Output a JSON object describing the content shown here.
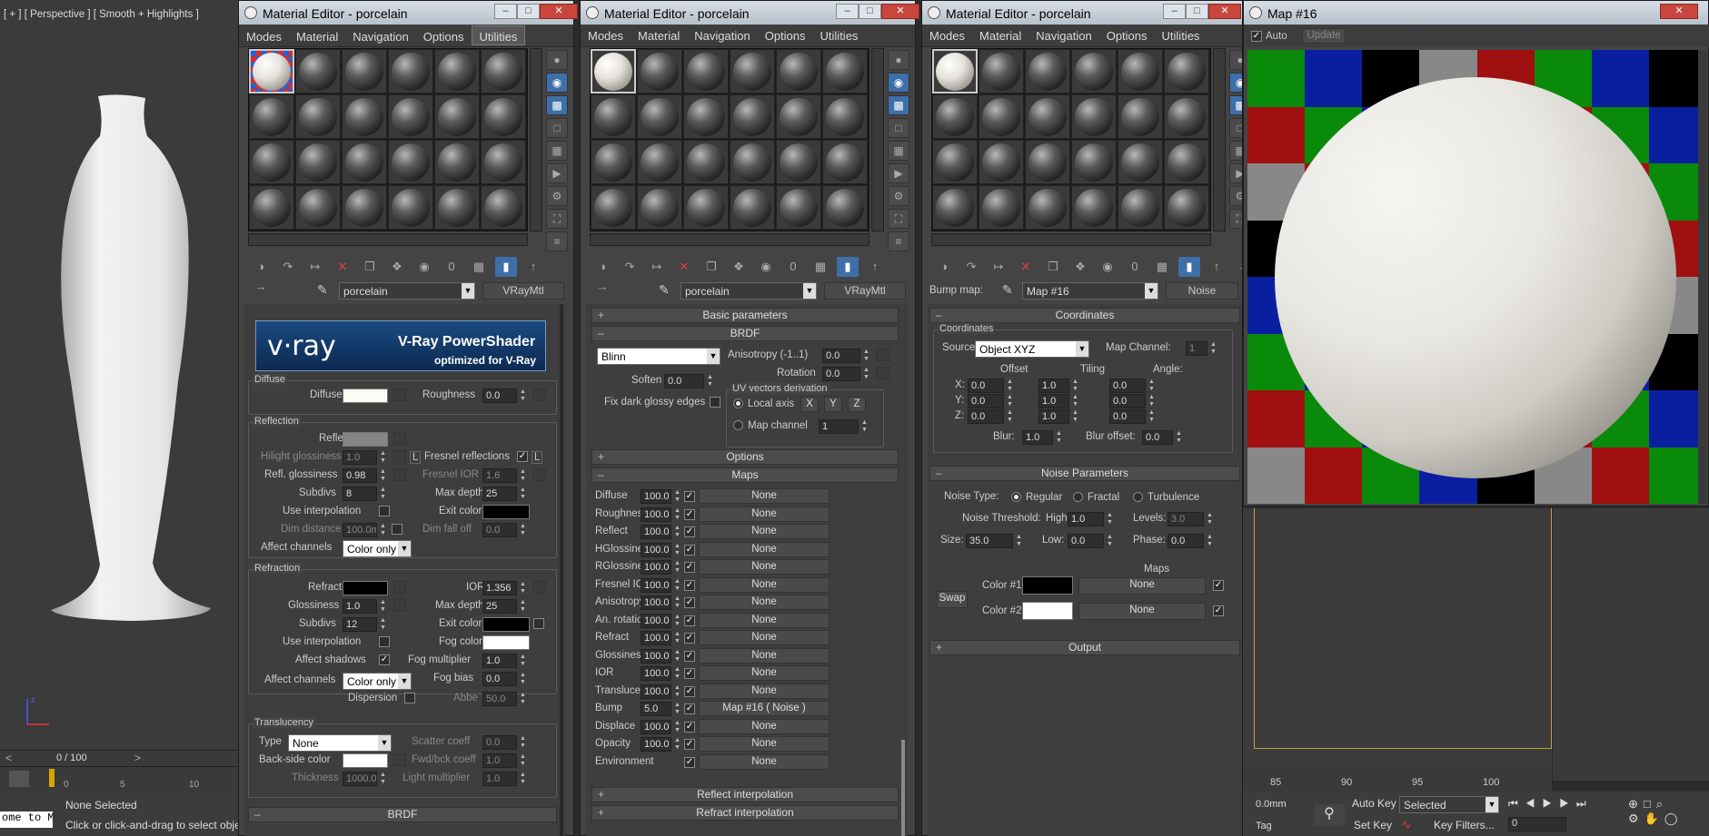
{
  "viewport": {
    "label": "[ + ] [ Perspective ] [ Smooth + Highlights ]",
    "timeline": "0 / 100",
    "ticks": [
      "0",
      "5",
      "10"
    ],
    "ticks_right": [
      "85",
      "90",
      "95",
      "100"
    ],
    "status": "None Selected",
    "prompt": "Click or click-and-drag to select objects",
    "script": "ome to M",
    "coord": "0.0mm",
    "tag": "Tag"
  },
  "anim": {
    "auto_key": "Auto Key",
    "set_key": "Set Key",
    "selected": "Selected",
    "key_filters": "Key Filters...",
    "frame": "0"
  },
  "menu": [
    "Modes",
    "Material",
    "Navigation",
    "Options",
    "Utilities"
  ],
  "ed1": {
    "title": "Material Editor - porcelain",
    "name": "porcelain",
    "type": "VRayMtl",
    "banner": {
      "logo": "v·ray",
      "title": "V-Ray PowerShader",
      "sub": "optimized for V-Ray"
    },
    "diffuse": {
      "group": "Diffuse",
      "diffuse": "Diffuse",
      "roughness": "Roughness",
      "rough_v": "0.0"
    },
    "reflection": {
      "group": "Reflection",
      "reflect": "Reflect",
      "hg": "Hilight glossiness",
      "hg_v": "1.0",
      "l": "L",
      "fresnel": "Fresnel reflections",
      "rg": "Refl. glossiness",
      "rg_v": "0.98",
      "fior": "Fresnel IOR",
      "fior_v": "1.6",
      "subdivs": "Subdivs",
      "subdivs_v": "8",
      "maxd": "Max depth",
      "maxd_v": "25",
      "useint": "Use interpolation",
      "exit": "Exit color",
      "dimd": "Dim distance",
      "dimd_v": "100.0m",
      "dimf": "Dim fall off",
      "dimf_v": "0.0",
      "affect": "Affect channels",
      "affect_v": "Color only"
    },
    "refraction": {
      "group": "Refraction",
      "refract": "Refract",
      "ior": "IOR",
      "ior_v": "1.356",
      "gloss": "Glossiness",
      "gloss_v": "1.0",
      "maxd": "Max depth",
      "maxd_v": "25",
      "subdivs": "Subdivs",
      "subdivs_v": "12",
      "exit": "Exit color",
      "useint": "Use interpolation",
      "fog": "Fog color",
      "shadows": "Affect shadows",
      "fogm": "Fog multiplier",
      "fogm_v": "1.0",
      "affect": "Affect channels",
      "affect_v": "Color only",
      "fogb": "Fog bias",
      "fogb_v": "0.0",
      "disp": "Dispersion",
      "abbe": "Abbe",
      "abbe_v": "50.0"
    },
    "translucency": {
      "group": "Translucency",
      "type": "Type",
      "type_v": "None",
      "scatter": "Scatter coeff",
      "scatter_v": "0.0",
      "back": "Back-side color",
      "fwd": "Fwd/bck coeff",
      "fwd_v": "1.0",
      "thick": "Thickness",
      "thick_v": "1000.0",
      "lm": "Light multiplier",
      "lm_v": "1.0"
    },
    "brdf": "BRDF"
  },
  "ed2": {
    "title": "Material Editor - porcelain",
    "name": "porcelain",
    "type": "VRayMtl",
    "basic": "Basic parameters",
    "brdf": "BRDF",
    "brdf_type": "Blinn",
    "aniso": "Anisotropy (-1..1)",
    "aniso_v": "0.0",
    "rotation": "Rotation",
    "rotation_v": "0.0",
    "soften": "Soften",
    "soften_v": "0.0",
    "uv": "UV vectors derivation",
    "local": "Local axis",
    "x": "X",
    "y": "Y",
    "z": "Z",
    "fixdark": "Fix dark glossy edges",
    "mapch": "Map channel",
    "mapch_v": "1",
    "options": "Options",
    "maps": "Maps",
    "maprows": [
      {
        "n": "Diffuse",
        "v": "100.0",
        "m": "None"
      },
      {
        "n": "Roughness",
        "v": "100.0",
        "m": "None"
      },
      {
        "n": "Reflect",
        "v": "100.0",
        "m": "None"
      },
      {
        "n": "HGlossiness",
        "v": "100.0",
        "m": "None"
      },
      {
        "n": "RGlossiness",
        "v": "100.0",
        "m": "None"
      },
      {
        "n": "Fresnel IOR",
        "v": "100.0",
        "m": "None"
      },
      {
        "n": "Anisotropy",
        "v": "100.0",
        "m": "None"
      },
      {
        "n": "An. rotation",
        "v": "100.0",
        "m": "None"
      },
      {
        "n": "Refract",
        "v": "100.0",
        "m": "None"
      },
      {
        "n": "Glossiness",
        "v": "100.0",
        "m": "None"
      },
      {
        "n": "IOR",
        "v": "100.0",
        "m": "None"
      },
      {
        "n": "Translucent",
        "v": "100.0",
        "m": "None"
      },
      {
        "n": "Bump",
        "v": "5.0",
        "m": "Map #16  ( Noise )"
      },
      {
        "n": "Displace",
        "v": "100.0",
        "m": "None"
      },
      {
        "n": "Opacity",
        "v": "100.0",
        "m": "None"
      },
      {
        "n": "Environment",
        "v": "",
        "m": "None"
      }
    ],
    "reflint": "Reflect interpolation",
    "refrint": "Refract interpolation"
  },
  "ed3": {
    "title": "Material Editor - porcelain",
    "bump": "Bump map:",
    "name": "Map #16",
    "type": "Noise",
    "coords": "Coordinates",
    "coords_g": "Coordinates",
    "source": "Source:",
    "source_v": "Object XYZ",
    "mapch": "Map Channel:",
    "mapch_v": "1",
    "offset": "Offset",
    "tiling": "Tiling",
    "angle": "Angle:",
    "rows": [
      {
        "a": "X:",
        "o": "0.0",
        "t": "1.0",
        "g": "0.0"
      },
      {
        "a": "Y:",
        "o": "0.0",
        "t": "1.0",
        "g": "0.0"
      },
      {
        "a": "Z:",
        "o": "0.0",
        "t": "1.0",
        "g": "0.0"
      }
    ],
    "blur": "Blur:",
    "blur_v": "1.0",
    "bluroff": "Blur offset:",
    "bluroff_v": "0.0",
    "noise": "Noise Parameters",
    "ntype": "Noise Type:",
    "regular": "Regular",
    "fractal": "Fractal",
    "turb": "Turbulence",
    "thresh": "Noise Threshold:",
    "high": "High:",
    "high_v": "1.0",
    "levels": "Levels:",
    "levels_v": "3.0",
    "size": "Size:",
    "size_v": "35.0",
    "low": "Low:",
    "low_v": "0.0",
    "phase": "Phase:",
    "phase_v": "0.0",
    "maps": "Maps",
    "swap": "Swap",
    "c1": "Color #1",
    "c2": "Color #2",
    "none1": "None",
    "none2": "None",
    "output": "Output"
  },
  "map16": {
    "title": "Map #16",
    "auto": "Auto",
    "update": "Update"
  }
}
